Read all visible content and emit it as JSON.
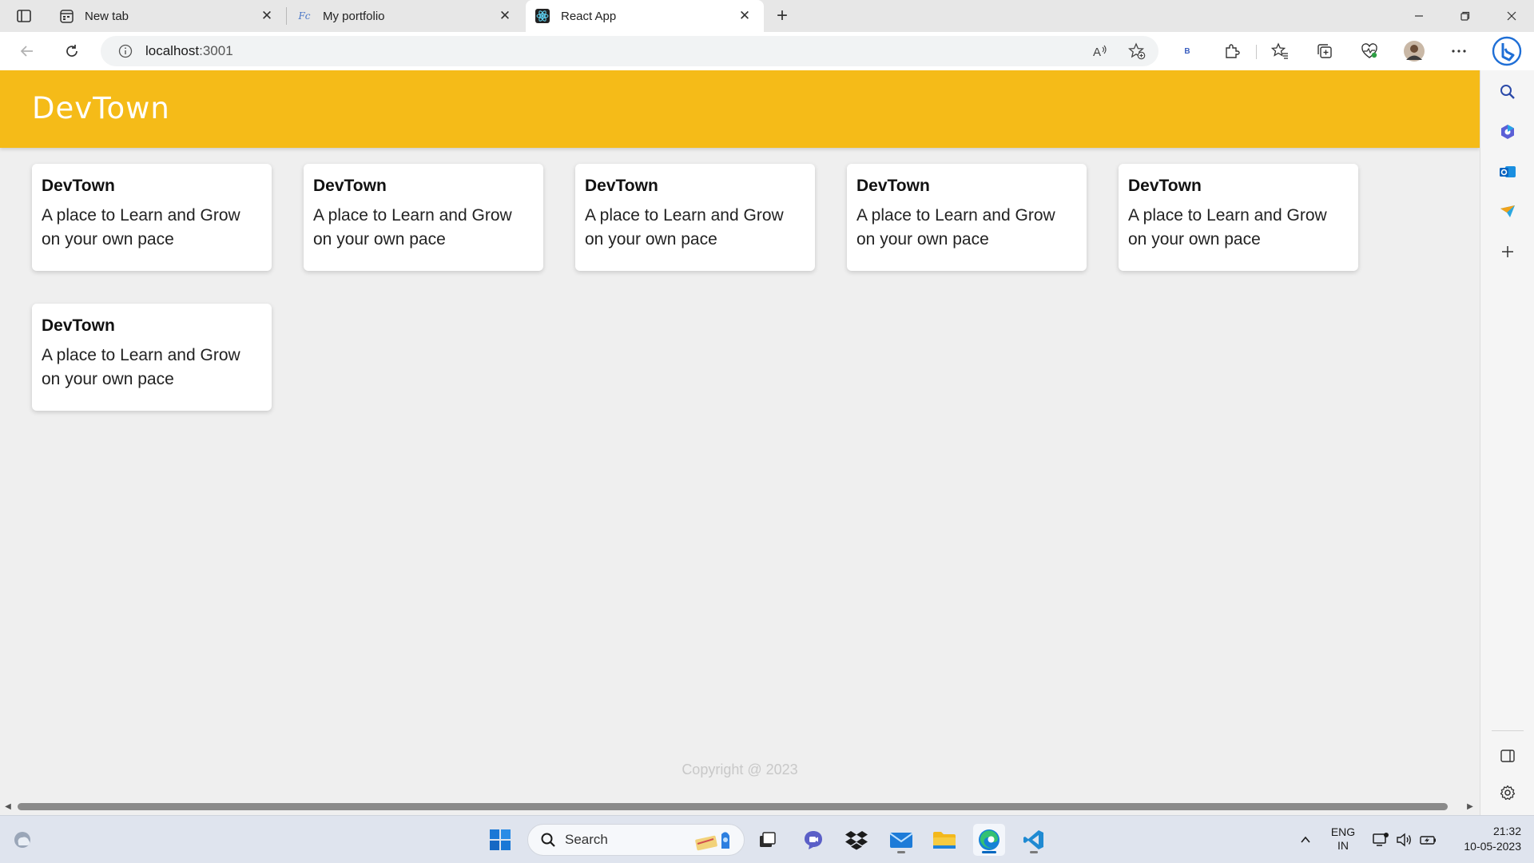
{
  "browser": {
    "tabs": [
      {
        "title": "New tab",
        "icon": "new-tab-page-icon",
        "active": false
      },
      {
        "title": "My portfolio",
        "icon": "portfolio-favicon",
        "active": false
      },
      {
        "title": "React App",
        "icon": "react-logo-icon",
        "active": true
      }
    ],
    "address": {
      "host": "localhost",
      "port": ":3001"
    },
    "profile_badge": "B"
  },
  "site": {
    "header_title": "DevTown",
    "cards": [
      {
        "title": "DevTown",
        "text": "A place to Learn and Grow on your own pace"
      },
      {
        "title": "DevTown",
        "text": "A place to Learn and Grow on your own pace"
      },
      {
        "title": "DevTown",
        "text": "A place to Learn and Grow on your own pace"
      },
      {
        "title": "DevTown",
        "text": "A place to Learn and Grow on your own pace"
      },
      {
        "title": "DevTown",
        "text": "A place to Learn and Grow on your own pace"
      },
      {
        "title": "DevTown",
        "text": "A place to Learn and Grow on your own pace"
      }
    ],
    "footer": "Copyright @ 2023",
    "colors": {
      "header": "#f5bb18",
      "page_bg": "#efefef",
      "card_bg": "#ffffff"
    }
  },
  "taskbar": {
    "search_label": "Search",
    "language": "ENG",
    "region": "IN",
    "time": "21:32",
    "date": "10-05-2023",
    "apps": [
      "windows-start-icon",
      "search",
      "widgets-icon",
      "task-view-icon",
      "teams-chat-icon",
      "dropbox-icon",
      "mail-icon",
      "file-explorer-icon",
      "edge-icon",
      "vscode-icon"
    ]
  }
}
